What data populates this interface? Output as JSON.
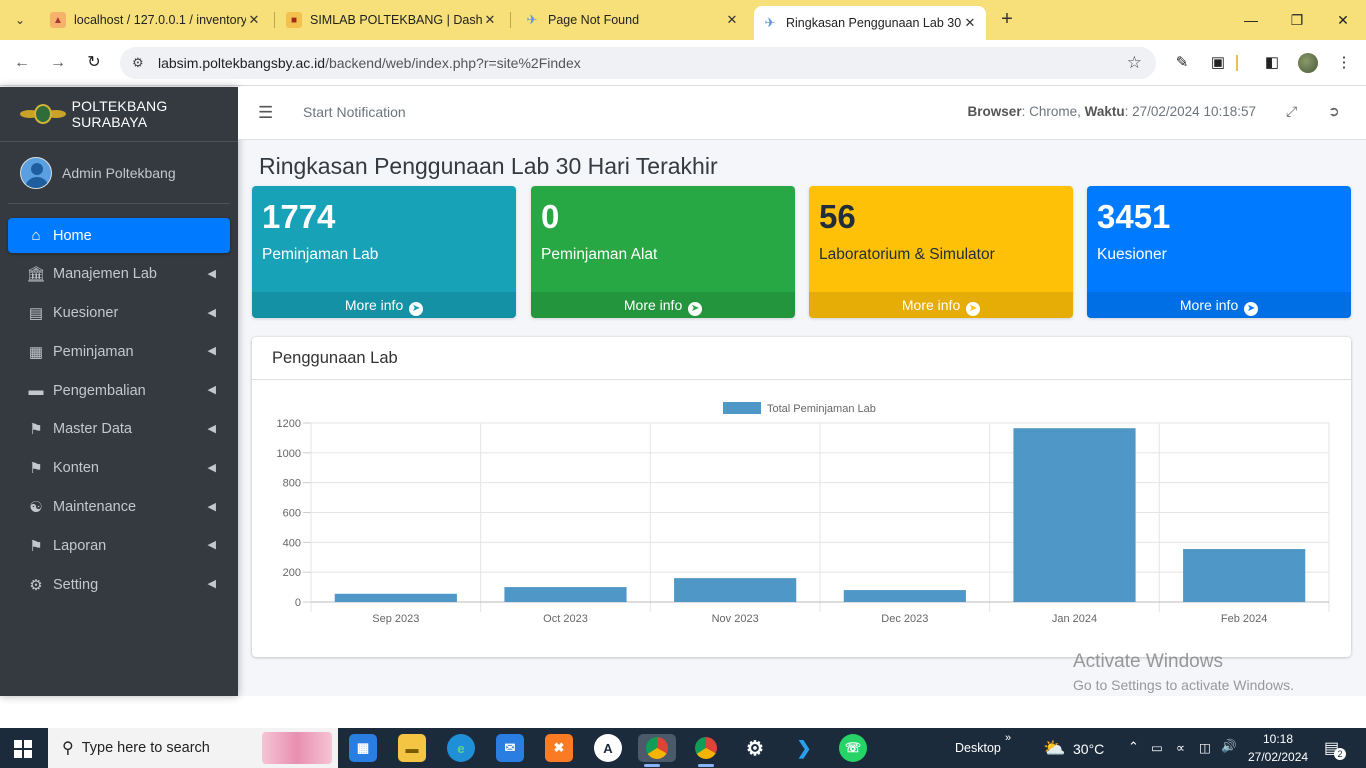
{
  "browser": {
    "tabs": [
      {
        "title": "localhost / 127.0.0.1 / inventory",
        "favicon": "phpmyadmin-icon"
      },
      {
        "title": "SIMLAB POLTEKBANG | Dashbo",
        "favicon": "simlab-icon"
      },
      {
        "title": "Page Not Found",
        "favicon": "plane-icon"
      },
      {
        "title": "Ringkasan Penggunaan Lab 30",
        "favicon": "plane-icon"
      }
    ],
    "url_host": "labsim.poltekbangsby.ac.id",
    "url_path": "/backend/web/index.php?r=site%2Findex"
  },
  "sidebar": {
    "brand": "POLTEKBANG SURABAYA",
    "user": "Admin Poltekbang",
    "items": [
      {
        "label": "Home",
        "icon": "home-icon"
      },
      {
        "label": "Manajemen Lab",
        "icon": "bank-icon"
      },
      {
        "label": "Kuesioner",
        "icon": "list-icon"
      },
      {
        "label": "Peminjaman",
        "icon": "archive-icon"
      },
      {
        "label": "Pengembalian",
        "icon": "folder-icon"
      },
      {
        "label": "Master Data",
        "icon": "tags-icon"
      },
      {
        "label": "Konten",
        "icon": "tags-icon"
      },
      {
        "label": "Maintenance",
        "icon": "users-icon"
      },
      {
        "label": "Laporan",
        "icon": "tags-icon"
      },
      {
        "label": "Setting",
        "icon": "gear-icon"
      }
    ]
  },
  "topnav": {
    "start_notification": "Start Notification",
    "browser_label": "Browser",
    "browser_value": ": Chrome,",
    "time_label": "Waktu",
    "time_value": ": 27/02/2024 10:18:57"
  },
  "page": {
    "title": "Ringkasan Penggunaan Lab 30 Hari Terakhir"
  },
  "stats": [
    {
      "value": "1774",
      "label": "Peminjaman Lab",
      "more": "More info",
      "color": "#17a2b8"
    },
    {
      "value": "0",
      "label": "Peminjaman Alat",
      "more": "More info",
      "color": "#28a745"
    },
    {
      "value": "56",
      "label": "Laboratorium & Simulator",
      "more": "More info",
      "color": "#ffc107"
    },
    {
      "value": "3451",
      "label": "Kuesioner",
      "more": "More info",
      "color": "#007bff"
    }
  ],
  "card": {
    "title": "Penggunaan Lab"
  },
  "chart_data": {
    "type": "bar",
    "categories": [
      "Sep 2023",
      "Oct 2023",
      "Nov 2023",
      "Dec 2023",
      "Jan 2024",
      "Feb 2024"
    ],
    "series": [
      {
        "name": "Total Peminjaman Lab",
        "values": [
          55,
          100,
          160,
          80,
          1165,
          355
        ],
        "color": "#4f97c7"
      }
    ],
    "ylim": [
      0,
      1200
    ],
    "yticks": [
      0,
      200,
      400,
      600,
      800,
      1000,
      1200
    ],
    "grid": true,
    "legend": "top"
  },
  "watermark": {
    "line1": "Activate Windows",
    "line2": "Go to Settings to activate Windows."
  },
  "taskbar": {
    "search_placeholder": "Type here to search",
    "desktop_label": "Desktop",
    "temperature": "30°C",
    "time": "10:18",
    "date": "27/02/2024",
    "notifications": "2"
  }
}
